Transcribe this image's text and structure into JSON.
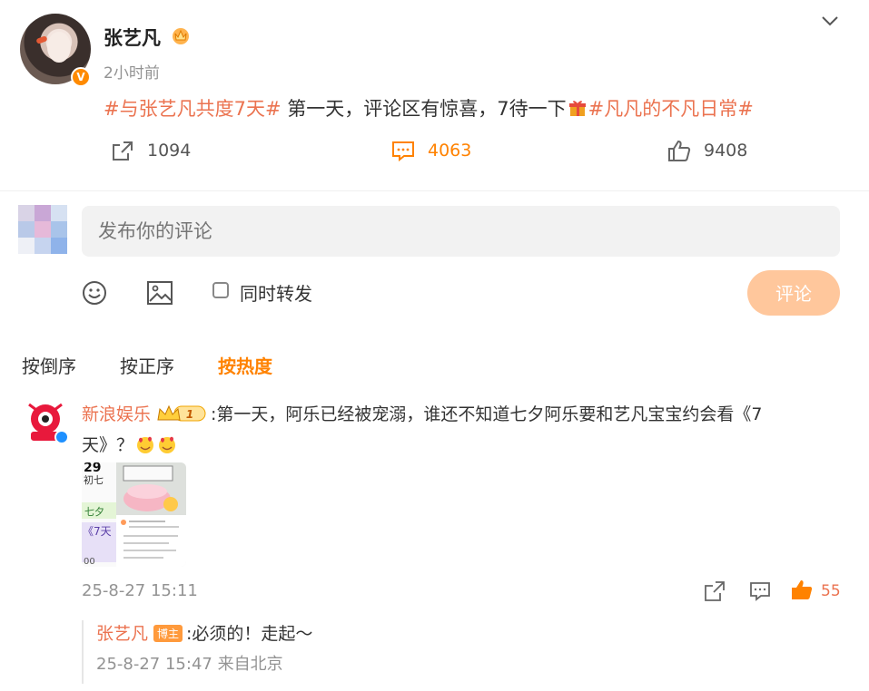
{
  "post": {
    "author": "张艺凡",
    "time": "2小时前",
    "badge": "V",
    "text_tag1": "#与张艺凡共度7天#",
    "text_body": " 第一天，评论区有惊喜，7待一下",
    "text_tag2": "#凡凡的不凡日常#",
    "reposts": "1094",
    "comments": "4063",
    "likes": "9408"
  },
  "compose": {
    "placeholder": "发布你的评论",
    "repost_label": "同时转发",
    "submit_label": "评论"
  },
  "sort": {
    "reverse": "按倒序",
    "forward": "按正序",
    "hot": "按热度"
  },
  "comment": {
    "user": "新浪娱乐",
    "vip_level": "1",
    "line1": ":第一天，阿乐已经被宠溺，谁还不知道七夕阿乐要和艺凡宝宝约会看《7",
    "line2": "天》？",
    "thumb_text": {
      "date": "29",
      "lunar": "初七",
      "qixi": "七夕",
      "movie": "《7天",
      "num": "00"
    },
    "time": "25-8-27 15:11",
    "like_count": "55"
  },
  "reply": {
    "user": "张艺凡",
    "badge": "博主",
    "text": ":必须的！走起～",
    "time": "25-8-27 15:47 来自北京"
  },
  "colors": {
    "accent": "#ff8200",
    "tag": "#eb7350",
    "submit": "#ffc79c"
  }
}
